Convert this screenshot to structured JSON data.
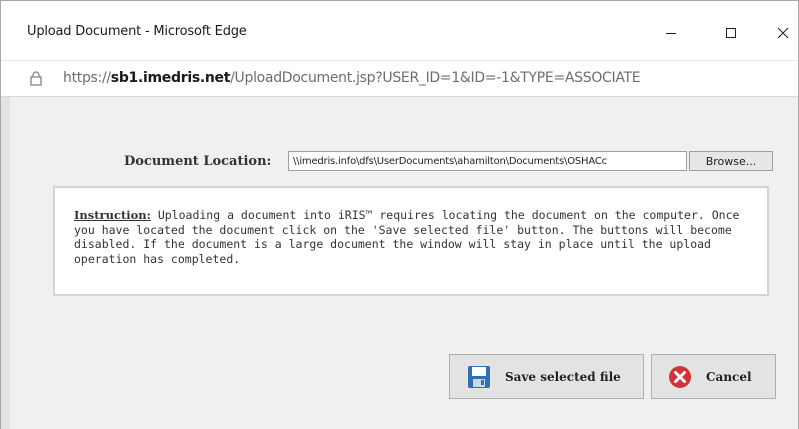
{
  "window": {
    "title": "Upload Document - Microsoft Edge",
    "controls": {
      "minimize": "minimize-icon",
      "maximize": "maximize-icon",
      "close": "close-icon"
    }
  },
  "address": {
    "scheme": "https://",
    "host": "sb1.imedris.net",
    "path": "/UploadDocument.jsp?USER_ID=1&ID=-1&TYPE=ASSOCIATE",
    "icon": "lock-icon"
  },
  "form": {
    "location_label": "Document Location:",
    "location_value": "\\\\imedris.info\\dfs\\UserDocuments\\ahamilton\\Documents\\OSHACc",
    "browse_label": "Browse..."
  },
  "instruction": {
    "heading": "Instruction:",
    "body": " Uploading a document into iRIS™ requires locating the document on the computer. Once you have located the document click on the 'Save selected file' button. The buttons will become disabled. If the document is a large document the window will stay in place until the upload operation has completed."
  },
  "actions": {
    "save_label": "Save selected file",
    "cancel_label": "Cancel"
  },
  "colors": {
    "content_bg": "#f0f0f0",
    "cancel_icon": "#d13438",
    "save_icon": "#2f6fb3"
  }
}
